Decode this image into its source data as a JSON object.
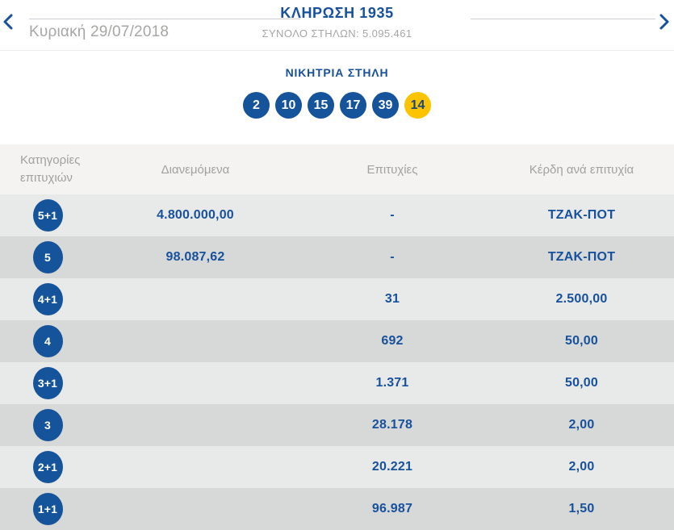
{
  "header": {
    "title": "ΚΛΗΡΩΣΗ 1935",
    "subtitle": "ΣΥΝΟΛΟ ΣΤΗΛΩΝ: 5.095.461",
    "date": "Κυριακή 29/07/2018",
    "prev_icon": "chevron-left",
    "next_icon": "chevron-right"
  },
  "winning": {
    "label": "ΝΙΚΗΤΡΙΑ ΣΤΗΛΗ",
    "numbers": [
      "2",
      "10",
      "15",
      "17",
      "39"
    ],
    "bonus_number": "14"
  },
  "table": {
    "headers": {
      "category": "Κατηγορίες επιτυχιών",
      "distributed": "Διανεμόμενα",
      "winners": "Επιτυχίες",
      "prize": "Κέρδη ανά επιτυχία"
    },
    "rows": [
      {
        "category": "5+1",
        "distributed": "4.800.000,00",
        "winners": "-",
        "prize": "ΤΖΑΚ-ΠΟΤ"
      },
      {
        "category": "5",
        "distributed": "98.087,62",
        "winners": "-",
        "prize": "ΤΖΑΚ-ΠΟΤ"
      },
      {
        "category": "4+1",
        "distributed": "",
        "winners": "31",
        "prize": "2.500,00"
      },
      {
        "category": "4",
        "distributed": "",
        "winners": "692",
        "prize": "50,00"
      },
      {
        "category": "3+1",
        "distributed": "",
        "winners": "1.371",
        "prize": "50,00"
      },
      {
        "category": "3",
        "distributed": "",
        "winners": "28.178",
        "prize": "2,00"
      },
      {
        "category": "2+1",
        "distributed": "",
        "winners": "20.221",
        "prize": "2,00"
      },
      {
        "category": "1+1",
        "distributed": "",
        "winners": "96.987",
        "prize": "1,50"
      }
    ]
  },
  "colors": {
    "accent_blue": "#17519c",
    "ball_blue": "#15549a",
    "bonus_yellow": "#fcc400",
    "bonus_text": "#1a4480",
    "muted_gray": "#a7a6a4",
    "thead_bg": "#f4f3f1",
    "row_light": "#e8e9e9",
    "row_dark": "#d7d8d8"
  }
}
